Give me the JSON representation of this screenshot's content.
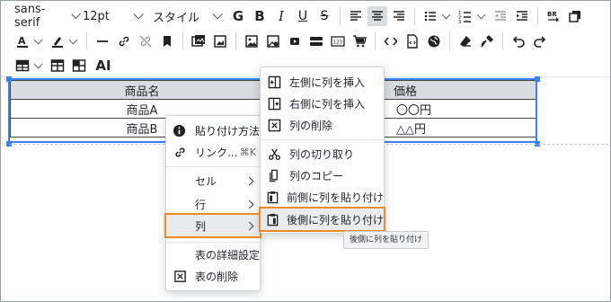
{
  "toolbar": {
    "font_family": "sans-serif",
    "font_size": "12pt",
    "style": "スタイル"
  },
  "table": {
    "headers": [
      "商品名",
      "価格"
    ],
    "rows": [
      [
        "商品A",
        "〇〇円"
      ],
      [
        "商品B",
        "△△円"
      ]
    ]
  },
  "context_menu": {
    "paste_method": "貼り付け方法",
    "link": "リンク...",
    "link_shortcut": "⌘K",
    "cell": "セル",
    "row": "行",
    "column": "列",
    "table_properties": "表の詳細設定",
    "delete_table": "表の削除"
  },
  "column_submenu": {
    "insert_left": "左側に列を挿入",
    "insert_right": "右側に列を挿入",
    "delete_column": "列の削除",
    "cut_column": "列の切り取り",
    "copy_column": "列のコピー",
    "paste_before": "前側に列を貼り付け",
    "paste_after": "後側に列を貼り付け"
  },
  "tooltip": "後側に列を貼り付け",
  "colors": {
    "highlight_outline": "#f08a24",
    "selection": "#3b82f6",
    "header_bg": "#d8dbe0"
  }
}
